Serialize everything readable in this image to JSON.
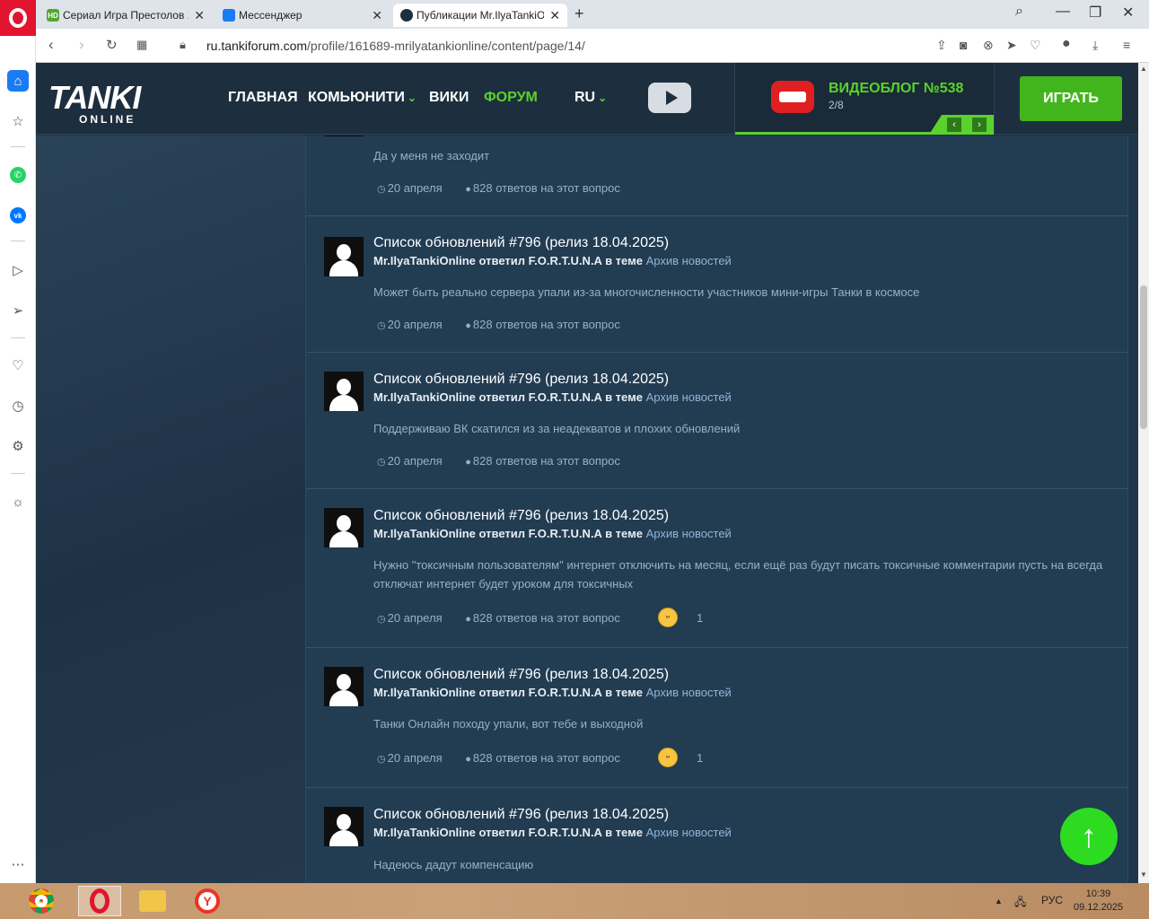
{
  "browser": {
    "tabs": [
      {
        "title": "Сериал Игра Престолов 1",
        "badge": "HD",
        "active": false
      },
      {
        "title": "Мессенджер",
        "active": false
      },
      {
        "title": "Публикации Mr.IlyaTankiO",
        "active": true
      }
    ],
    "url_host": "ru.tankiforum.com",
    "url_path": "/profile/161689-mrilyatankionline/content/page/14/"
  },
  "site": {
    "logo_big": "TANKI",
    "logo_small": "ONLINE",
    "nav": {
      "home": "ГЛАВНАЯ",
      "community": "КОМЬЮНИТИ",
      "wiki": "ВИКИ",
      "forum": "ФОРУМ",
      "lang": "RU"
    },
    "videoblog": {
      "title": "ВИДЕОБЛОГ №538",
      "counter": "2/8"
    },
    "play_label": "ИГРАТЬ"
  },
  "posts": [
    {
      "title": "",
      "meta_user": "",
      "meta_forum": "",
      "text": "Да у меня не заходит",
      "date": "20 апреля",
      "answers": "828 ответов на этот вопрос",
      "reactions": null
    },
    {
      "title": "Список обновлений #796 (релиз 18.04.2025)",
      "meta_user": "Mr.IlyaTankiOnline ответил F.O.R.T.U.N.A в теме",
      "meta_forum": "Архив новостей",
      "text": "Может быть реально сервера упали из-за многочисленности участников мини-игры Танки в космосе",
      "date": "20 апреля",
      "answers": "828 ответов на этот вопрос",
      "reactions": null
    },
    {
      "title": "Список обновлений #796 (релиз 18.04.2025)",
      "meta_user": "Mr.IlyaTankiOnline ответил F.O.R.T.U.N.A в теме",
      "meta_forum": "Архив новостей",
      "text": "Поддерживаю ВК скатился из за неадекватов и плохих обновлений",
      "date": "20 апреля",
      "answers": "828 ответов на этот вопрос",
      "reactions": null
    },
    {
      "title": "Список обновлений #796 (релиз 18.04.2025)",
      "meta_user": "Mr.IlyaTankiOnline ответил F.O.R.T.U.N.A в теме",
      "meta_forum": "Архив новостей",
      "text": "Нужно \"токсичным пользователям\" интернет отключить на месяц, если ещё раз будут писать токсичные комментарии пусть на всегда отключат интернет будет уроком для токсичных",
      "date": "20 апреля",
      "answers": "828 ответов на этот вопрос",
      "reactions": "1"
    },
    {
      "title": "Список обновлений #796 (релиз 18.04.2025)",
      "meta_user": "Mr.IlyaTankiOnline ответил F.O.R.T.U.N.A в теме",
      "meta_forum": "Архив новостей",
      "text": "Танки Онлайн походу упали, вот тебе и выходной",
      "date": "20 апреля",
      "answers": "828 ответов на этот вопрос",
      "reactions": "1"
    },
    {
      "title": "Список обновлений #796 (релиз 18.04.2025)",
      "meta_user": "Mr.IlyaTankiOnline ответил F.O.R.T.U.N.A в теме",
      "meta_forum": "Архив новостей",
      "text": "Надеюсь дадут компенсацию",
      "date": "",
      "answers": "",
      "reactions": null
    }
  ],
  "taskbar": {
    "lang": "РУС",
    "time": "10:39",
    "date": "09.12.2025"
  },
  "colors": {
    "accent_green": "#5ad22c",
    "play_green": "#43b51c",
    "opera_red": "#e2142d"
  }
}
